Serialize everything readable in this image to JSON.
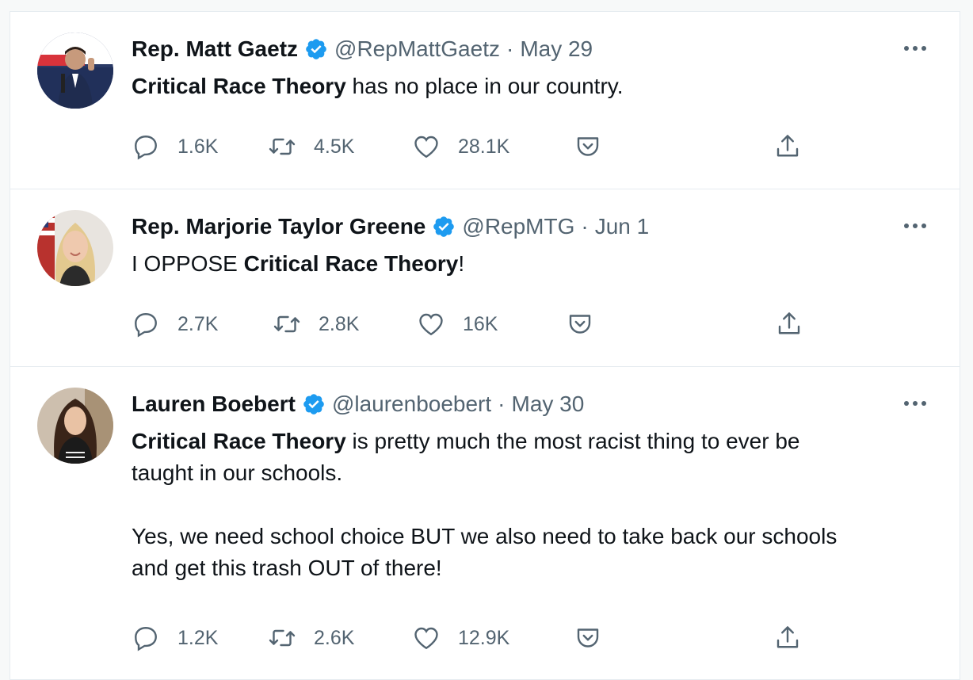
{
  "tweets": [
    {
      "name": "Rep. Matt Gaetz",
      "handle": "@RepMattGaetz",
      "separator": "·",
      "date": "May 29",
      "text_parts": [
        {
          "bold": "Critical Race Theory",
          "rest": " has no place in our country."
        }
      ],
      "replies": "1.6K",
      "retweets": "4.5K",
      "likes": "28.1K",
      "avatar_icon": "avatar-photo",
      "accent": "#1d9bf0"
    },
    {
      "name": "Rep. Marjorie Taylor Greene",
      "handle": "@RepMTG",
      "separator": "·",
      "date": "Jun 1",
      "text_pre": "I OPPOSE ",
      "text_bold": "Critical Race Theory",
      "text_post": "!",
      "replies": "2.7K",
      "retweets": "2.8K",
      "likes": "16K",
      "avatar_icon": "avatar-photo",
      "accent": "#1d9bf0"
    },
    {
      "name": "Lauren Boebert",
      "handle": "@laurenboebert",
      "separator": "·",
      "date": "May 30",
      "text_bold": "Critical Race Theory",
      "text_line1_rest": " is pretty much the most racist thing to ever be",
      "text_line2": "taught in our schools.",
      "text_line3": "Yes, we need school choice BUT we also need to take back our schools",
      "text_line4": "and get this trash OUT of there!",
      "replies": "1.2K",
      "retweets": "2.6K",
      "likes": "12.9K",
      "avatar_icon": "avatar-photo",
      "accent": "#1d9bf0"
    }
  ],
  "icons": {
    "reply": "reply-icon",
    "retweet": "retweet-icon",
    "like": "heart-icon",
    "save": "pocket-save-icon",
    "share": "share-icon",
    "more": "more-icon",
    "verified": "verified-badge-icon"
  },
  "colors": {
    "text": "#0f1419",
    "muted": "#536471",
    "verified": "#1d9bf0",
    "border": "#e6ecf0"
  }
}
